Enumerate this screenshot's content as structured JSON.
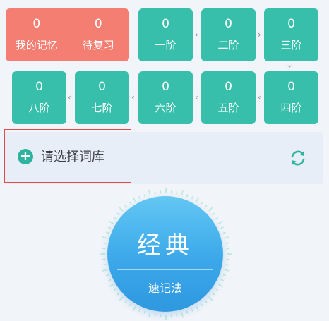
{
  "top_card": {
    "my_memory": {
      "count": "0",
      "label": "我的记忆"
    },
    "to_review": {
      "count": "0",
      "label": "待复习"
    }
  },
  "stages_row1": [
    {
      "count": "0",
      "label": "一阶"
    },
    {
      "count": "0",
      "label": "二阶"
    },
    {
      "count": "0",
      "label": "三阶"
    }
  ],
  "stages_row2": [
    {
      "count": "0",
      "label": "八阶"
    },
    {
      "count": "0",
      "label": "七阶"
    },
    {
      "count": "0",
      "label": "六阶"
    },
    {
      "count": "0",
      "label": "五阶"
    },
    {
      "count": "0",
      "label": "四阶"
    }
  ],
  "banner": {
    "label": "请选择词库",
    "add_icon": "plus-circle-icon",
    "refresh_icon": "refresh-icon"
  },
  "main_button": {
    "title": "经典",
    "subtitle": "速记法"
  },
  "colors": {
    "teal": "#37bfac",
    "coral": "#f47e71",
    "blue": "#3ba8ea",
    "highlight": "#e04a4a"
  }
}
